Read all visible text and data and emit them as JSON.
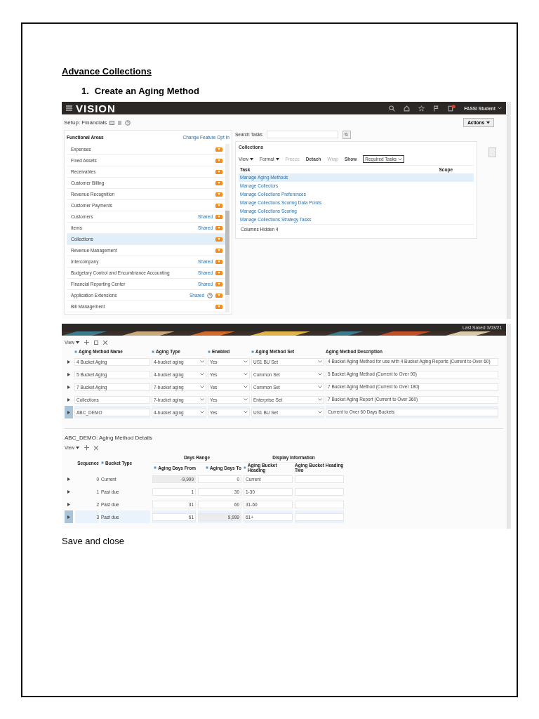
{
  "document": {
    "heading": "Advance Collections",
    "step": {
      "number": "1.",
      "text": "Create an Aging Method"
    },
    "closing": "Save and close"
  },
  "setup_screen": {
    "header": {
      "logo": "VISION",
      "user": "FASSI Student"
    },
    "page_title": "Setup: Financials",
    "actions_button": "Actions",
    "functional_areas": {
      "title": "Functional Areas",
      "link": "Change Feature Opt In",
      "items": [
        {
          "label": "Expenses",
          "help": false,
          "selected": false
        },
        {
          "label": "Fixed Assets",
          "help": false,
          "selected": false
        },
        {
          "label": "Receivables",
          "help": false,
          "selected": false
        },
        {
          "label": "Customer Billing",
          "help": false,
          "selected": false
        },
        {
          "label": "Revenue Recognition",
          "help": false,
          "selected": false
        },
        {
          "label": "Customer Payments",
          "help": false,
          "selected": false
        },
        {
          "label": "Customers",
          "badge": "Shared",
          "help": false,
          "selected": false
        },
        {
          "label": "Items",
          "badge": "Shared",
          "help": false,
          "selected": false
        },
        {
          "label": "Collections",
          "help": false,
          "selected": true
        },
        {
          "label": "Revenue Management",
          "help": false,
          "selected": false
        },
        {
          "label": "Intercompany",
          "badge": "Shared",
          "help": false,
          "selected": false
        },
        {
          "label": "Budgetary Control and Encumbrance Accounting",
          "badge": "Shared",
          "help": false,
          "selected": false
        },
        {
          "label": "Financial Reporting Center",
          "badge": "Shared",
          "help": false,
          "selected": false
        },
        {
          "label": "Application Extensions",
          "badge": "Shared",
          "help": true,
          "selected": false
        },
        {
          "label": "Bill Management",
          "help": false,
          "selected": false
        }
      ]
    },
    "search": {
      "label": "Search Tasks"
    },
    "collections": {
      "title": "Collections",
      "toolbar": {
        "view": "View",
        "format": "Format",
        "freeze": "Freeze",
        "detach": "Detach",
        "wrap": "Wrap",
        "show_label": "Show",
        "show_value": "Required Tasks"
      },
      "columns": [
        "Task",
        "Scope"
      ],
      "tasks": [
        {
          "label": "Manage Aging Methods",
          "selected": true
        },
        {
          "label": "Manage Collectors",
          "selected": false
        },
        {
          "label": "Manage Collections Preferences",
          "selected": false
        },
        {
          "label": "Manage Collections Scoring Data Points",
          "selected": false
        },
        {
          "label": "Manage Collections Scoring",
          "selected": false
        },
        {
          "label": "Manage Collections Strategy Tasks",
          "selected": false
        }
      ],
      "columns_hidden": "Columns Hidden  4"
    }
  },
  "aging_screen": {
    "last_saved": "Last Saved 3/03/21",
    "view": "View",
    "columns": [
      {
        "label": "Aging Method Name",
        "required": true
      },
      {
        "label": "Aging Type",
        "required": true
      },
      {
        "label": "Enabled",
        "required": true
      },
      {
        "label": "Aging Method Set",
        "required": true
      },
      {
        "label": "Aging Method Description",
        "required": false
      }
    ],
    "rows": [
      {
        "name": "4 Bucket Aging",
        "type": "4-bucket aging",
        "enabled": "Yes",
        "set": "US1 BU Set",
        "description": "4 Bucket Aging Method for use with 4 Bucket Aging Reports (Current to Over 60)",
        "selected": false
      },
      {
        "name": "5 Bucket Aging",
        "type": "4-bucket aging",
        "enabled": "Yes",
        "set": "Common Set",
        "description": "5 Bucket Aging Method (Current to Over 90)",
        "selected": false
      },
      {
        "name": "7 Bucket Aging",
        "type": "7-bucket aging",
        "enabled": "Yes",
        "set": "Common Set",
        "description": "7 Bucket Aging Method (Current to Over 180)",
        "selected": false
      },
      {
        "name": "Collections",
        "type": "7-bucket aging",
        "enabled": "Yes",
        "set": "Enterprise Set",
        "description": "7 Bucket Aging Report (Current to Over 360)",
        "selected": false
      },
      {
        "name": "ABC_DEMO",
        "type": "4-bucket aging",
        "enabled": "Yes",
        "set": "US1 BU Set",
        "description": "Current to Over 60 Days Buckets",
        "selected": true
      }
    ],
    "details": {
      "title": "ABC_DEMO: Aging Method Details",
      "view": "View",
      "group_days": "Days Range",
      "group_display": "Display Information",
      "columns": [
        {
          "label": "Sequence",
          "required": false
        },
        {
          "label": "Bucket Type",
          "required": true
        },
        {
          "label": "Aging Days From",
          "required": true
        },
        {
          "label": "Aging Days To",
          "required": true
        },
        {
          "label": "Aging Bucket Heading",
          "required": true
        },
        {
          "label": "Aging Bucket Heading Two",
          "required": false
        }
      ],
      "rows": [
        {
          "sequence": "0",
          "type": "Current",
          "from": "-9,999",
          "from_locked": true,
          "to": "0",
          "to_locked": false,
          "heading": "Current",
          "selected": false
        },
        {
          "sequence": "1",
          "type": "Past due",
          "from": "1",
          "from_locked": false,
          "to": "30",
          "to_locked": false,
          "heading": "1-30",
          "selected": false
        },
        {
          "sequence": "2",
          "type": "Past due",
          "from": "31",
          "from_locked": false,
          "to": "60",
          "to_locked": false,
          "heading": "31-60",
          "selected": false
        },
        {
          "sequence": "3",
          "type": "Past due",
          "from": "61",
          "from_locked": false,
          "to": "9,999",
          "to_locked": true,
          "heading": "61+",
          "selected": true
        }
      ]
    }
  }
}
